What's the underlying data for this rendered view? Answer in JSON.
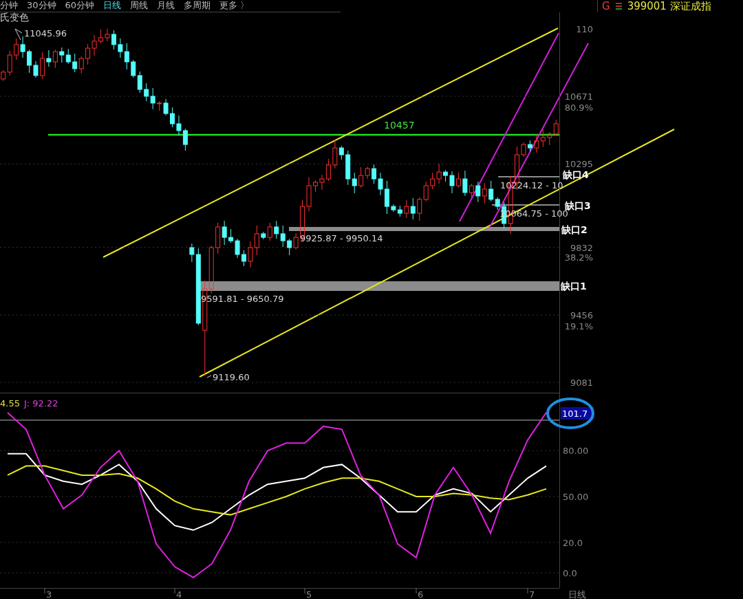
{
  "toolbar": {
    "periods": [
      {
        "label": "分钟",
        "selected": false
      },
      {
        "label": "30分钟",
        "selected": false
      },
      {
        "label": "60分钟",
        "selected": false
      },
      {
        "label": "日线",
        "selected": true
      },
      {
        "label": "周线",
        "selected": false
      },
      {
        "label": "月线",
        "selected": false
      },
      {
        "label": "多周期",
        "selected": false
      },
      {
        "label": "更多 〉",
        "selected": false
      }
    ]
  },
  "security": {
    "market_tag": "G",
    "code_name": "399001 深证成指"
  },
  "price_chart": {
    "indicator_label": "氏变色",
    "high_label": "11045.96",
    "low_label": "9119.60",
    "gaps": [
      {
        "tag": "缺口4",
        "range": "10224.12 - 10"
      },
      {
        "tag": "缺口3",
        "range": "10064.75 - 100"
      },
      {
        "tag": "缺口2",
        "range": "9925.87 - 9950.14"
      },
      {
        "tag": "缺口1",
        "range": "9591.81 - 9650.79"
      }
    ],
    "top_axis_label": "110",
    "percent_labels": [
      "80.9%",
      "38.2%",
      "19.1%"
    ],
    "chart_data": {
      "type": "candlestick",
      "grid": true,
      "categories": [
        null,
        null,
        null,
        null,
        null,
        null,
        null,
        null,
        null,
        null,
        null,
        null,
        null,
        null,
        null,
        null,
        null,
        null,
        null,
        null,
        null,
        null,
        null,
        null,
        null,
        null,
        null,
        null,
        null,
        null,
        null,
        null,
        null,
        null,
        null,
        null,
        null,
        null,
        null,
        null,
        null,
        null,
        null,
        null,
        null,
        null,
        null,
        null,
        null,
        null,
        null,
        null,
        null,
        null,
        null,
        null,
        null,
        null,
        null,
        null,
        null,
        null,
        null,
        null,
        null,
        null,
        null,
        null,
        null,
        null,
        null,
        null,
        null,
        null,
        null,
        null,
        null,
        null,
        null,
        null,
        null,
        null,
        null,
        null,
        null,
        null
      ],
      "ohlc": [
        [
          10767,
          10816,
          10756,
          10805
        ],
        [
          10805,
          10923,
          10786,
          10900
        ],
        [
          10900,
          10992,
          10873,
          10958
        ],
        [
          10958,
          11004,
          10885,
          10919
        ],
        [
          10919,
          10930,
          10801,
          10843
        ],
        [
          10843,
          10866,
          10775,
          10786
        ],
        [
          10786,
          10915,
          10767,
          10881
        ],
        [
          10881,
          10927,
          10835,
          10862
        ],
        [
          10862,
          10930,
          10828,
          10919
        ],
        [
          10919,
          10942,
          10858,
          10900
        ],
        [
          10900,
          10934,
          10851,
          10862
        ],
        [
          10862,
          10908,
          10805,
          10824
        ],
        [
          10824,
          10892,
          10797,
          10881
        ],
        [
          10881,
          10961,
          10847,
          10938
        ],
        [
          10938,
          11011,
          10896,
          10977
        ],
        [
          10977,
          11042,
          10966,
          10996
        ],
        [
          10996,
          11046,
          10977,
          11015
        ],
        [
          11015,
          11038,
          10931,
          10958
        ],
        [
          10958,
          10992,
          10885,
          10919
        ],
        [
          10919,
          10965,
          10820,
          10862
        ],
        [
          10862,
          10873,
          10775,
          10786
        ],
        [
          10786,
          10809,
          10690,
          10709
        ],
        [
          10709,
          10743,
          10644,
          10671
        ],
        [
          10671,
          10717,
          10599,
          10633
        ],
        [
          10633,
          10644,
          10591,
          10633
        ],
        [
          10633,
          10656,
          10564,
          10575
        ],
        [
          10575,
          10609,
          10499,
          10518
        ],
        [
          10518,
          10564,
          10453,
          10480
        ],
        [
          10480,
          10491,
          10369,
          10403
        ],
        [
          9830,
          9853,
          9750,
          9792
        ],
        [
          9792,
          9826,
          9399,
          9410
        ],
        [
          9371,
          9647,
          9120,
          9601
        ],
        [
          9601,
          9841,
          9574,
          9830
        ],
        [
          9830,
          9968,
          9796,
          9945
        ],
        [
          9945,
          9979,
          9845,
          9887
        ],
        [
          9887,
          9933,
          9857,
          9868
        ],
        [
          9868,
          9879,
          9773,
          9792
        ],
        [
          9792,
          9815,
          9727,
          9754
        ],
        [
          9754,
          9864,
          9720,
          9830
        ],
        [
          9830,
          9953,
          9788,
          9907
        ],
        [
          9907,
          9918,
          9876,
          9887
        ],
        [
          9887,
          9968,
          9868,
          9945
        ],
        [
          9945,
          9979,
          9880,
          9907
        ],
        [
          9907,
          9953,
          9834,
          9868
        ],
        [
          9868,
          9879,
          9788,
          9830
        ],
        [
          9830,
          9910,
          9819,
          9887
        ],
        [
          9887,
          10093,
          9868,
          10059
        ],
        [
          10059,
          10220,
          10032,
          10174
        ],
        [
          10174,
          10204,
          10140,
          10193
        ],
        [
          10193,
          10235,
          10151,
          10212
        ],
        [
          10212,
          10323,
          10201,
          10289
        ],
        [
          10289,
          10430,
          10270,
          10384
        ],
        [
          10384,
          10395,
          10319,
          10346
        ],
        [
          10346,
          10369,
          10178,
          10212
        ],
        [
          10212,
          10246,
          10132,
          10174
        ],
        [
          10174,
          10277,
          10163,
          10231
        ],
        [
          10231,
          10280,
          10212,
          10269
        ],
        [
          10269,
          10292,
          10185,
          10212
        ],
        [
          10212,
          10246,
          10121,
          10155
        ],
        [
          10155,
          10201,
          10017,
          10059
        ],
        [
          10059,
          10070,
          10029,
          10040
        ],
        [
          10040,
          10063,
          10002,
          10021
        ],
        [
          10021,
          10093,
          9994,
          10059
        ],
        [
          10059,
          10105,
          9987,
          10021
        ],
        [
          10021,
          10109,
          9979,
          10098
        ],
        [
          10098,
          10197,
          10087,
          10174
        ],
        [
          10174,
          10246,
          10155,
          10212
        ],
        [
          10212,
          10296,
          10185,
          10250
        ],
        [
          10250,
          10261,
          10197,
          10231
        ],
        [
          10231,
          10254,
          10132,
          10174
        ],
        [
          10174,
          10246,
          10163,
          10212
        ],
        [
          10212,
          10258,
          10117,
          10136
        ],
        [
          10136,
          10185,
          10109,
          10174
        ],
        [
          10174,
          10197,
          10083,
          10117
        ],
        [
          10117,
          10189,
          10075,
          10155
        ],
        [
          10155,
          10201,
          10087,
          10098
        ],
        [
          10098,
          10109,
          10040,
          10059
        ],
        [
          10059,
          10082,
          9937,
          9964
        ],
        [
          9964,
          10227,
          9905,
          10193
        ],
        [
          10193,
          10392,
          10151,
          10346
        ],
        [
          10346,
          10414,
          10335,
          10403
        ],
        [
          10403,
          10426,
          10365,
          10384
        ],
        [
          10384,
          10457,
          10357,
          10423
        ],
        [
          10423,
          10488,
          10389,
          10442
        ],
        [
          10442,
          10472,
          10400,
          10461
        ],
        [
          10461,
          10541,
          10450,
          10518
        ]
      ],
      "ylim": [
        9024,
        11137
      ],
      "yticks": [
        {
          "value": 10671,
          "label": "10671"
        },
        {
          "value": 10295,
          "label": "10295"
        },
        {
          "value": 9832,
          "label": "9832"
        },
        {
          "value": 9456,
          "label": "9456"
        },
        {
          "value": 9081,
          "label": "9081"
        }
      ]
    },
    "level_line_label": "10457"
  },
  "kdj": {
    "legend": [
      {
        "text": "4.55",
        "color": "#e0e040"
      },
      {
        "text": "J: 92.22",
        "color": "#e040e0"
      }
    ],
    "current_value": "101.7",
    "chart_data": {
      "type": "line",
      "grid": true,
      "categories": [
        null,
        null,
        "3",
        null,
        null,
        null,
        null,
        null,
        null,
        "4",
        null,
        null,
        null,
        null,
        null,
        null,
        "5",
        null,
        null,
        null,
        null,
        null,
        "6",
        null,
        null,
        null,
        null,
        null,
        "7",
        null
      ],
      "series": [
        {
          "color": "#ffffff",
          "values": [
            78,
            78,
            64,
            60,
            58,
            64,
            71,
            60,
            42,
            31,
            28,
            33,
            42,
            51,
            58,
            60,
            62,
            69,
            71,
            62,
            51,
            40,
            40,
            51,
            55,
            52,
            40,
            51,
            62,
            70
          ]
        },
        {
          "color": "#e8e820",
          "values": [
            64,
            70,
            70,
            67,
            64,
            64,
            65,
            62,
            55,
            47,
            42,
            40,
            38,
            42,
            46,
            50,
            55,
            59,
            62,
            62,
            60,
            55,
            50,
            50,
            52,
            51,
            49,
            48,
            51,
            55
          ]
        },
        {
          "color": "#e020e0",
          "values": [
            105,
            94,
            64,
            42,
            51,
            69,
            80,
            60,
            19,
            4,
            -3,
            6,
            28,
            60,
            80,
            85,
            85,
            96,
            94,
            64,
            51,
            19,
            10,
            51,
            69,
            51,
            26,
            60,
            87,
            105
          ]
        }
      ],
      "ylim": [
        -9.9,
        118
      ],
      "yticks": [
        {
          "value": 80,
          "label": "80.00"
        },
        {
          "value": 50,
          "label": "50.00"
        },
        {
          "value": 20,
          "label": "20.0"
        },
        {
          "value": 0,
          "label": "0.0"
        }
      ]
    }
  },
  "period_label": "日线"
}
